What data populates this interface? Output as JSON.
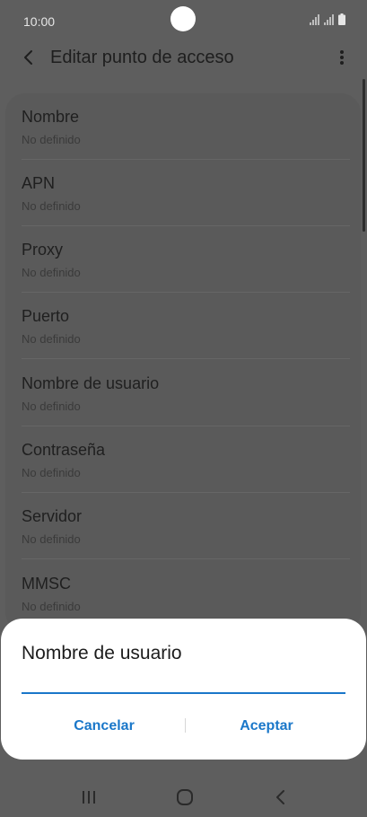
{
  "status_bar": {
    "time": "10:00"
  },
  "app_bar": {
    "title": "Editar punto de acceso"
  },
  "settings": [
    {
      "title": "Nombre",
      "summary": "No definido"
    },
    {
      "title": "APN",
      "summary": "No definido"
    },
    {
      "title": "Proxy",
      "summary": "No definido"
    },
    {
      "title": "Puerto",
      "summary": "No definido"
    },
    {
      "title": "Nombre de usuario",
      "summary": "No definido"
    },
    {
      "title": "Contraseña",
      "summary": "No definido"
    },
    {
      "title": "Servidor",
      "summary": "No definido"
    },
    {
      "title": "MMSC",
      "summary": "No definido"
    }
  ],
  "dialog": {
    "title": "Nombre de usuario",
    "input_value": "",
    "cancel_label": "Cancelar",
    "accept_label": "Aceptar"
  },
  "colors": {
    "accent": "#1a77c9",
    "dim_overlay": "#5e5e5e",
    "dialog_bg": "#ffffff"
  },
  "icons": {
    "back": "back-arrow-icon",
    "more": "more-vertical-icon",
    "signal": "signal-icon",
    "battery": "battery-icon",
    "nav_recents": "recents-icon",
    "nav_home": "home-icon",
    "nav_back": "nav-back-icon"
  }
}
